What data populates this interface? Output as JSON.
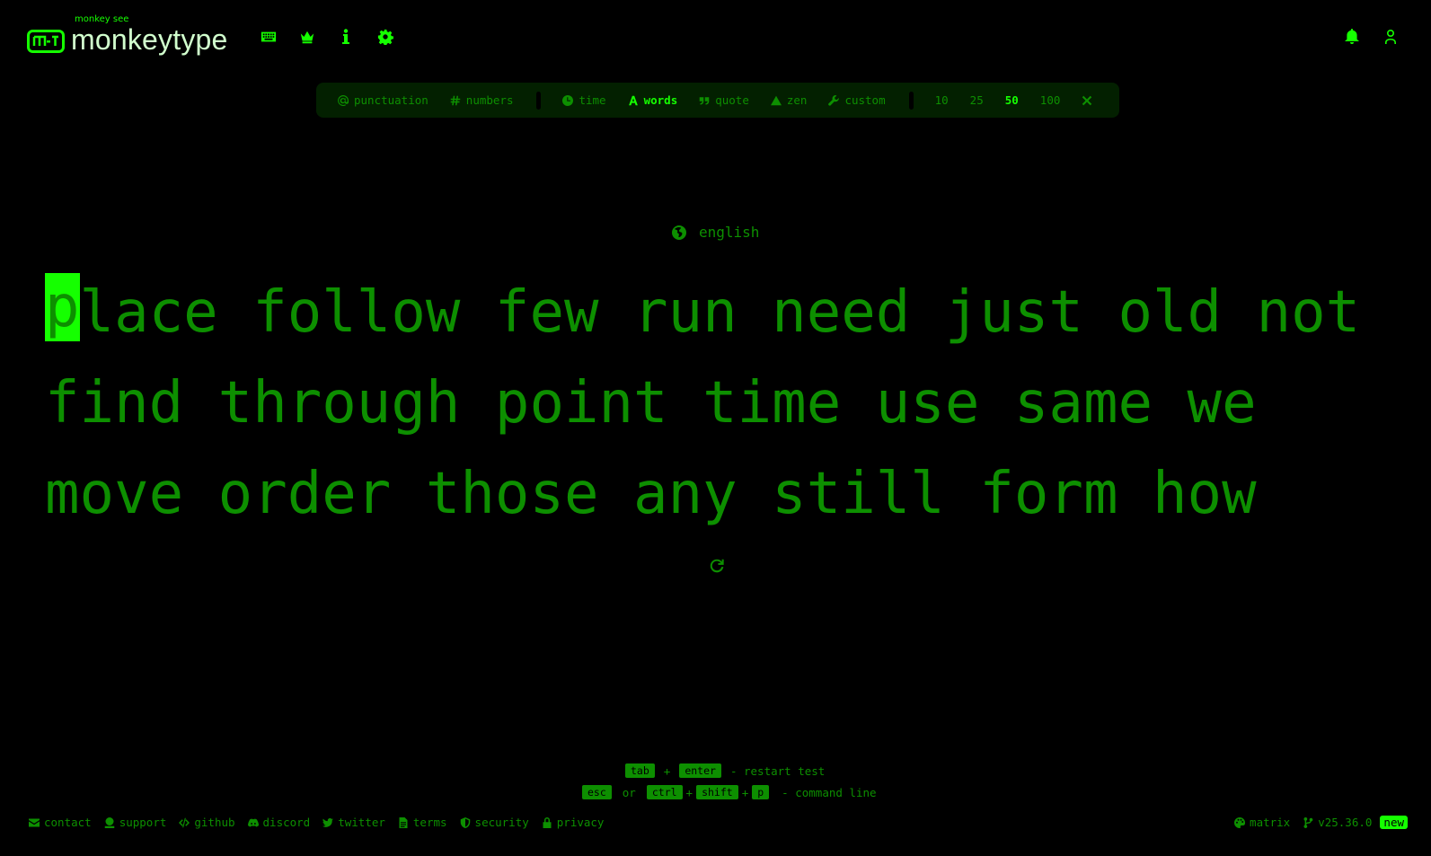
{
  "header": {
    "logo_top": "monkey see",
    "logo_text": "monkeytype",
    "nav_icons": [
      "keyboard-icon",
      "crown-icon",
      "info-icon",
      "gear-icon"
    ],
    "right_icons": [
      "bell-icon",
      "user-icon"
    ]
  },
  "config": {
    "punctuation": "punctuation",
    "numbers": "numbers",
    "time": "time",
    "words": "words",
    "quote": "quote",
    "zen": "zen",
    "custom": "custom",
    "counts": [
      "10",
      "25",
      "50",
      "100"
    ],
    "active_mode": "words",
    "active_count": "50"
  },
  "language": "english",
  "words": {
    "caret_letter": "p",
    "line1_rest": "lace follow few run need just old not",
    "line2": "find through point time use same we",
    "line3": "move order those any still form how"
  },
  "hints": {
    "tab": "tab",
    "plus": "+",
    "enter": "enter",
    "restart": "- restart test",
    "esc": "esc",
    "or": "or",
    "ctrl": "ctrl",
    "shift": "shift",
    "p": "p",
    "command": "- command line"
  },
  "footer": {
    "contact": "contact",
    "support": "support",
    "github": "github",
    "discord": "discord",
    "twitter": "twitter",
    "terms": "terms",
    "security": "security",
    "privacy": "privacy",
    "theme": "matrix",
    "version": "v25.36.0",
    "new_badge": "new"
  },
  "colors": {
    "background": "#000000",
    "main": "#15ff00",
    "sub": "#0d8f00",
    "sub_alt": "#032000",
    "logo_text": "#d1ffcd"
  }
}
